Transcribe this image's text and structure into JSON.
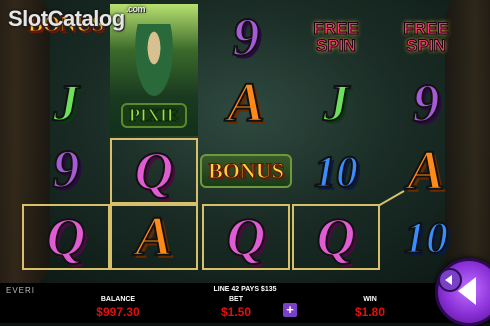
{
  "logo": {
    "text": "SlotCatalog",
    "suffix": ".com"
  },
  "reels": {
    "symbols": {
      "bonus": "BONUS",
      "pixie": "PIXIE",
      "free_spin_line1": "FREE",
      "free_spin_line2": "SPIN",
      "j": "J",
      "nine": "9",
      "q": "Q",
      "a": "A",
      "ten": "10"
    }
  },
  "footer": {
    "brand": "EVERI",
    "win_line": "LINE 42 PAYS $135",
    "balance_label": "BALANCE",
    "balance_value": "$997.30",
    "bet_label": "BET",
    "bet_value": "$1.50",
    "win_label": "WIN",
    "win_value": "$1.80",
    "bet_plus": "+"
  },
  "colors": {
    "accent": "#8a30d8",
    "value_red": "#e01010",
    "win_outline": "#d8c06a"
  }
}
